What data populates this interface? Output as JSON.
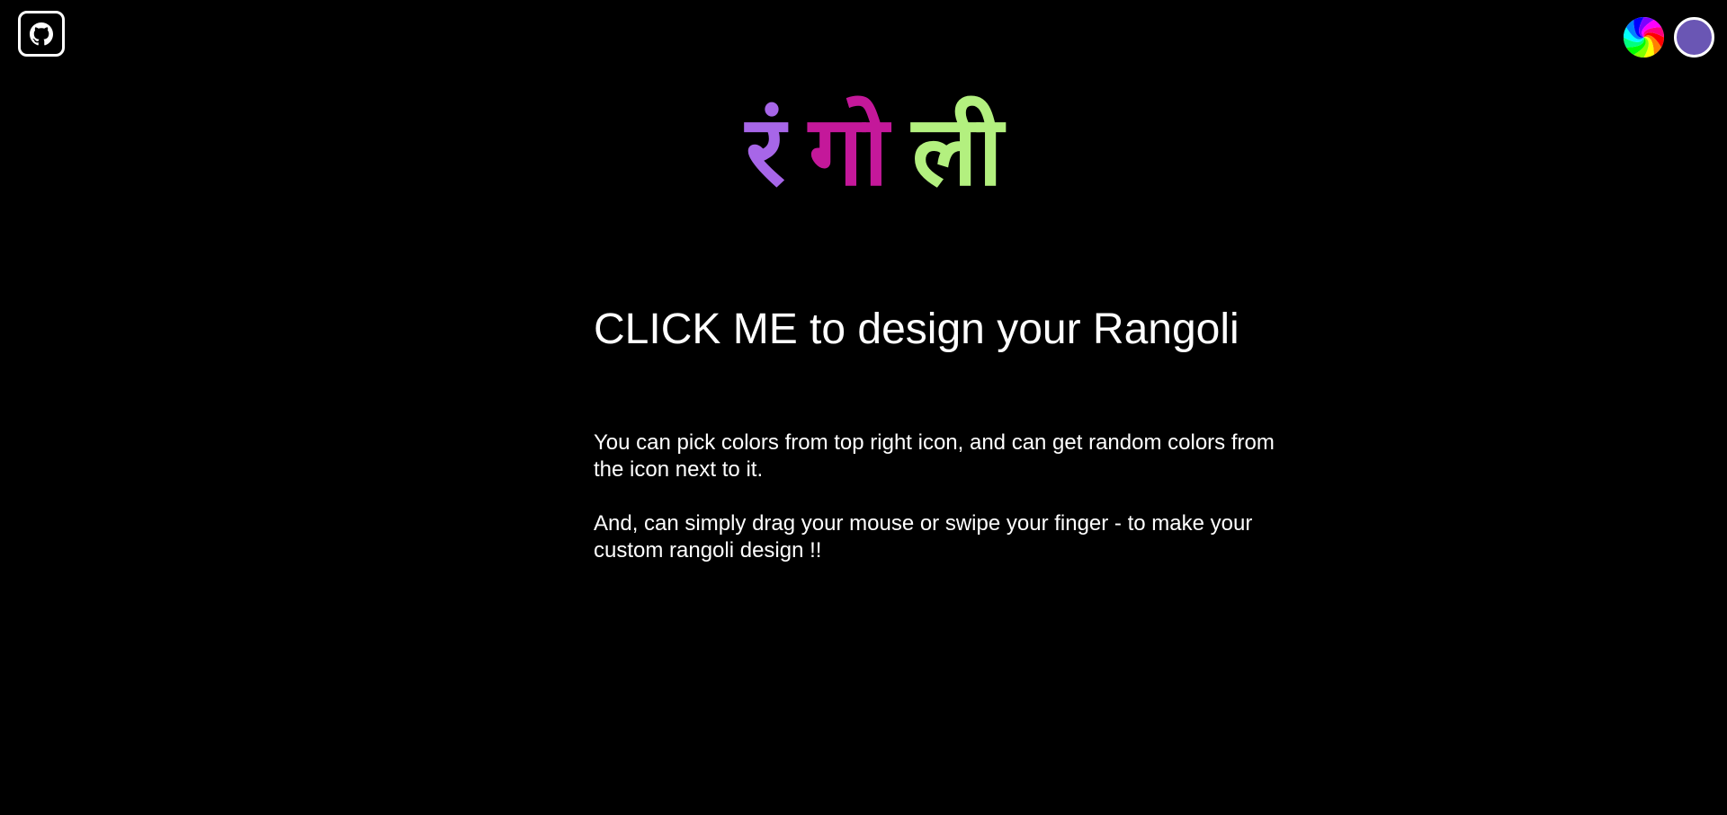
{
  "header": {
    "github_icon": "github-icon",
    "random_colors_icon": "color-wheel-icon",
    "selected_color": "#6a56b4"
  },
  "title": {
    "parts": [
      {
        "text": "रं",
        "color": "#a766e8"
      },
      {
        "text": "गो",
        "color": "#c4189a"
      },
      {
        "text": "ली",
        "color": "#b3f07f"
      }
    ]
  },
  "main": {
    "cta": "CLICK ME to design your Rangoli",
    "paragraphs": [
      "You can pick colors from top right icon, and can get random colors from the icon next to it.",
      "And, can simply drag your mouse or swipe your finger - to make your custom rangoli design !!"
    ]
  }
}
